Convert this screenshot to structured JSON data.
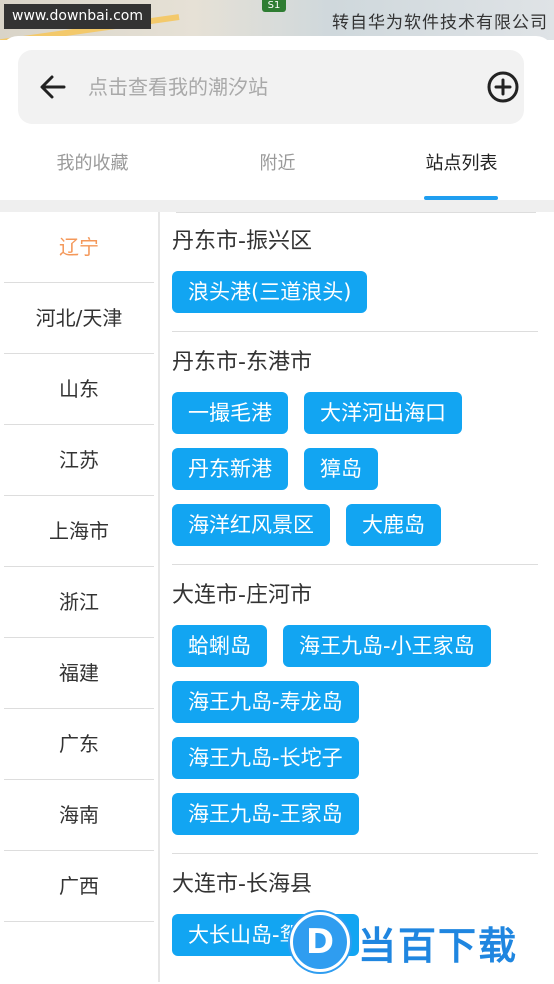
{
  "watermark": {
    "site": "www.downbai.com",
    "credit": "转自华为软件技术有限公司",
    "logo_letter": "D",
    "brand": "当百下载"
  },
  "map": {
    "shield_label": "S1"
  },
  "search": {
    "placeholder": "点击查看我的潮汐站",
    "back_icon": "arrow-left-icon",
    "add_icon": "plus-circle-icon"
  },
  "tabs": [
    {
      "label": "我的收藏"
    },
    {
      "label": "附近"
    },
    {
      "label": "站点列表",
      "active": true
    }
  ],
  "provinces": [
    "辽宁",
    "河北/天津",
    "山东",
    "江苏",
    "上海市",
    "浙江",
    "福建",
    "广东",
    "海南",
    "广西"
  ],
  "active_province": "辽宁",
  "groups": [
    {
      "title": "丹东市-振兴区",
      "stations": [
        "浪头港(三道浪头)"
      ]
    },
    {
      "title": "丹东市-东港市",
      "stations": [
        "一撮毛港",
        "大洋河出海口",
        "丹东新港",
        "獐岛",
        "海洋红风景区",
        "大鹿岛"
      ]
    },
    {
      "title": "大连市-庄河市",
      "stations": [
        "蛤蜊岛",
        "海王九岛-小王家岛",
        "海王九岛-寿龙岛",
        "海王九岛-长坨子",
        "海王九岛-王家岛"
      ]
    },
    {
      "title": "大连市-长海县",
      "stations": [
        "大长山岛-鸳鸯港"
      ]
    }
  ],
  "colors": {
    "accent": "#12a5f2",
    "active_province": "#f4985a",
    "tab_underline": "#1f9ef0"
  }
}
